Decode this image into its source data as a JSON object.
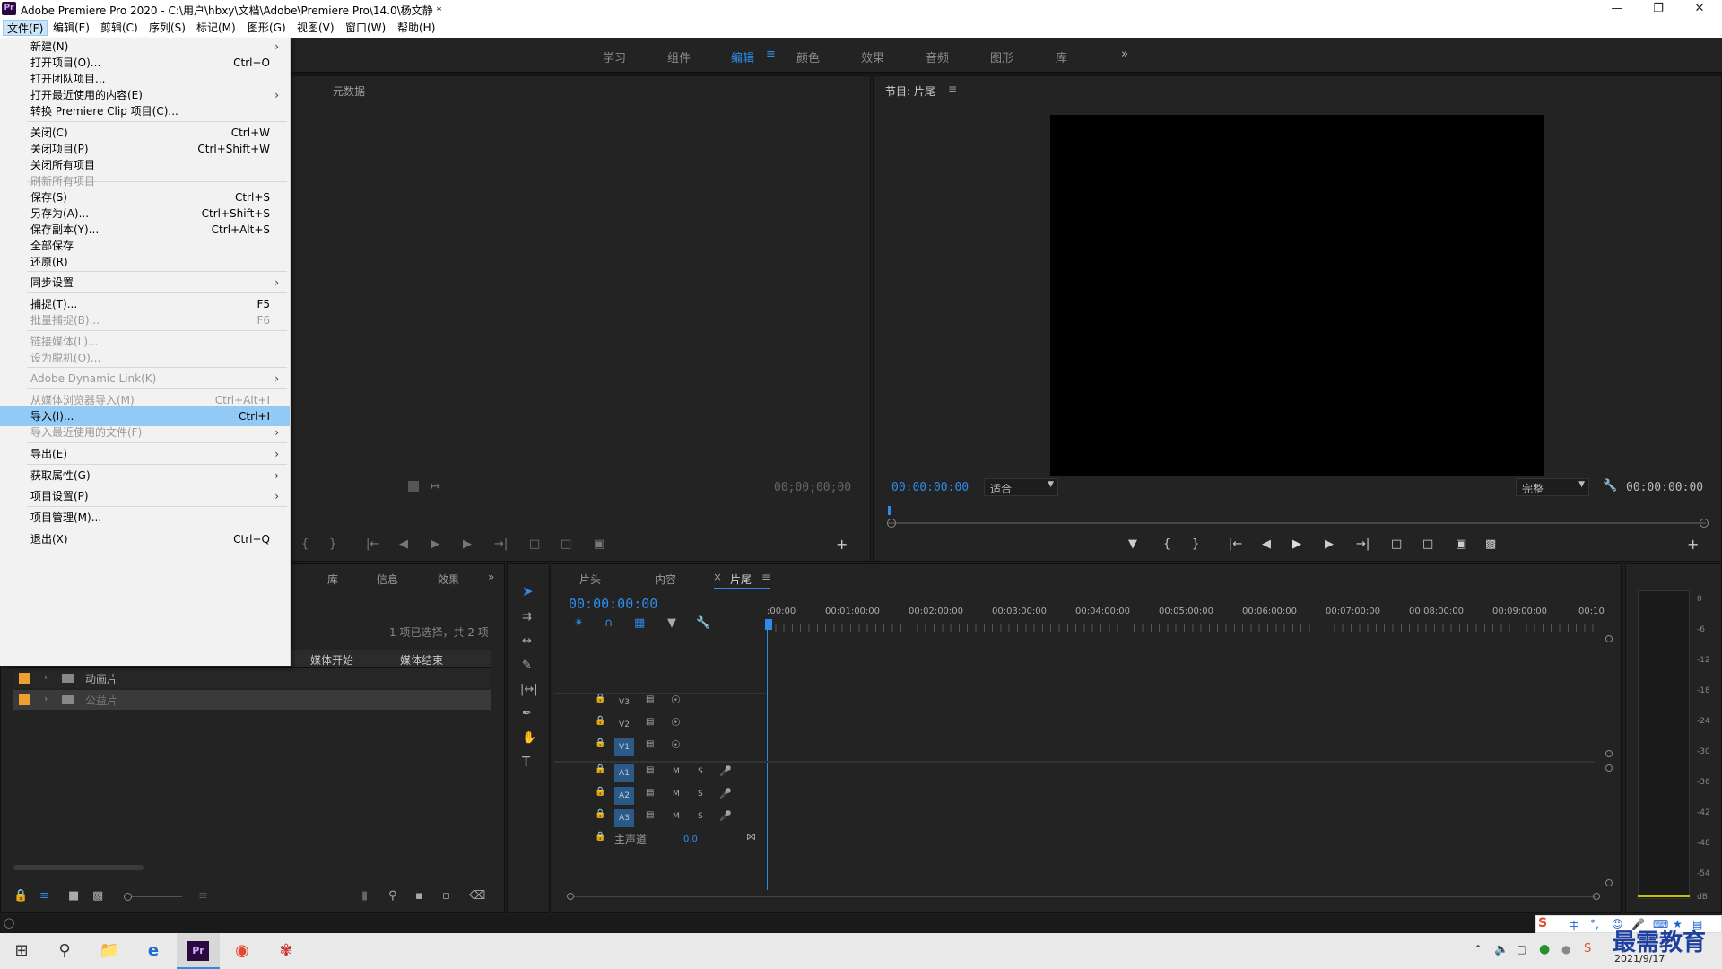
{
  "window": {
    "title": "Adobe Premiere Pro 2020 - C:\\用户\\hbxy\\文档\\Adobe\\Premiere Pro\\14.0\\杨文静 *",
    "app_icon": "Pr"
  },
  "menubar": [
    "文件(F)",
    "编辑(E)",
    "剪辑(C)",
    "序列(S)",
    "标记(M)",
    "图形(G)",
    "视图(V)",
    "窗口(W)",
    "帮助(H)"
  ],
  "workspaces": [
    "学习",
    "组件",
    "编辑",
    "颜色",
    "效果",
    "音频",
    "图形",
    "库"
  ],
  "workspace_more": "»",
  "file_menu": [
    {
      "label": "新建(N)",
      "shortcut": "",
      "submenu": true,
      "disabled": false
    },
    {
      "label": "打开项目(O)...",
      "shortcut": "Ctrl+O",
      "submenu": false,
      "disabled": false
    },
    {
      "label": "打开团队项目...",
      "shortcut": "",
      "submenu": false,
      "disabled": false
    },
    {
      "label": "打开最近使用的内容(E)",
      "shortcut": "",
      "submenu": true,
      "disabled": false
    },
    {
      "label": "转换 Premiere Clip 项目(C)...",
      "shortcut": "",
      "submenu": false,
      "disabled": false
    },
    {
      "label": "关闭(C)",
      "shortcut": "Ctrl+W",
      "submenu": false,
      "disabled": false
    },
    {
      "label": "关闭项目(P)",
      "shortcut": "Ctrl+Shift+W",
      "submenu": false,
      "disabled": false
    },
    {
      "label": "关闭所有项目",
      "shortcut": "",
      "submenu": false,
      "disabled": false
    },
    {
      "label": "刷新所有项目",
      "shortcut": "",
      "submenu": false,
      "disabled": true
    },
    {
      "label": "保存(S)",
      "shortcut": "Ctrl+S",
      "submenu": false,
      "disabled": false
    },
    {
      "label": "另存为(A)...",
      "shortcut": "Ctrl+Shift+S",
      "submenu": false,
      "disabled": false
    },
    {
      "label": "保存副本(Y)...",
      "shortcut": "Ctrl+Alt+S",
      "submenu": false,
      "disabled": false
    },
    {
      "label": "全部保存",
      "shortcut": "",
      "submenu": false,
      "disabled": false
    },
    {
      "label": "还原(R)",
      "shortcut": "",
      "submenu": false,
      "disabled": false
    },
    {
      "label": "同步设置",
      "shortcut": "",
      "submenu": true,
      "disabled": false
    },
    {
      "label": "捕捉(T)...",
      "shortcut": "F5",
      "submenu": false,
      "disabled": false
    },
    {
      "label": "批量捕捉(B)...",
      "shortcut": "F6",
      "submenu": false,
      "disabled": true
    },
    {
      "label": "链接媒体(L)...",
      "shortcut": "",
      "submenu": false,
      "disabled": true
    },
    {
      "label": "设为脱机(O)...",
      "shortcut": "",
      "submenu": false,
      "disabled": true
    },
    {
      "label": "Adobe Dynamic Link(K)",
      "shortcut": "",
      "submenu": true,
      "disabled": true
    },
    {
      "label": "从媒体浏览器导入(M)",
      "shortcut": "Ctrl+Alt+I",
      "submenu": false,
      "disabled": true
    },
    {
      "label": "导入(I)...",
      "shortcut": "Ctrl+I",
      "submenu": false,
      "disabled": false,
      "highlighted": true
    },
    {
      "label": "导入最近使用的文件(F)",
      "shortcut": "",
      "submenu": true,
      "disabled": true
    },
    {
      "label": "导出(E)",
      "shortcut": "",
      "submenu": true,
      "disabled": false
    },
    {
      "label": "获取属性(G)",
      "shortcut": "",
      "submenu": true,
      "disabled": false
    },
    {
      "label": "项目设置(P)",
      "shortcut": "",
      "submenu": true,
      "disabled": false
    },
    {
      "label": "项目管理(M)...",
      "shortcut": "",
      "submenu": false,
      "disabled": false
    },
    {
      "label": "退出(X)",
      "shortcut": "Ctrl+Q",
      "submenu": false,
      "disabled": false
    }
  ],
  "source_panel": {
    "tab": "元数据",
    "timecode": "00;00;00;00"
  },
  "program_panel": {
    "title": "节目: 片尾",
    "timecode_left": "00:00:00:00",
    "fit": "适合",
    "quality": "完整",
    "timecode_right": "00:00:00:00"
  },
  "project_panel": {
    "tabs": [
      "库",
      "信息",
      "效果"
    ],
    "status": "1 项已选择，共 2 项",
    "columns": [
      "媒体开始",
      "媒体结束"
    ],
    "items": [
      {
        "name": "动画片",
        "color": "#f0a030"
      },
      {
        "name": "公益片",
        "color": "#f0a030"
      }
    ]
  },
  "timeline": {
    "tabs": [
      "片头",
      "内容",
      "片尾"
    ],
    "active_tab": "片尾",
    "timecode": "00:00:00:00",
    "ruler": [
      ":00:00",
      "00:01:00:00",
      "00:02:00:00",
      "00:03:00:00",
      "00:04:00:00",
      "00:05:00:00",
      "00:06:00:00",
      "00:07:00:00",
      "00:08:00:00",
      "00:09:00:00",
      "00:10"
    ],
    "video_tracks": [
      "V3",
      "V2",
      "V1"
    ],
    "audio_tracks": [
      "A1",
      "A2",
      "A3"
    ],
    "master": "主声道",
    "master_value": "0.0",
    "mute": "M",
    "solo": "S"
  },
  "meter": {
    "scale": [
      "0",
      "-6",
      "-12",
      "-18",
      "-24",
      "-30",
      "-36",
      "-42",
      "-48",
      "-54",
      "dB"
    ]
  },
  "taskbar": {
    "time": "2021/9/17",
    "ime": "中",
    "watermark": "最需教育"
  },
  "colors": {
    "accent": "#2d8ceb",
    "highlight": "#91c9f7",
    "label_orange": "#f0a030"
  }
}
